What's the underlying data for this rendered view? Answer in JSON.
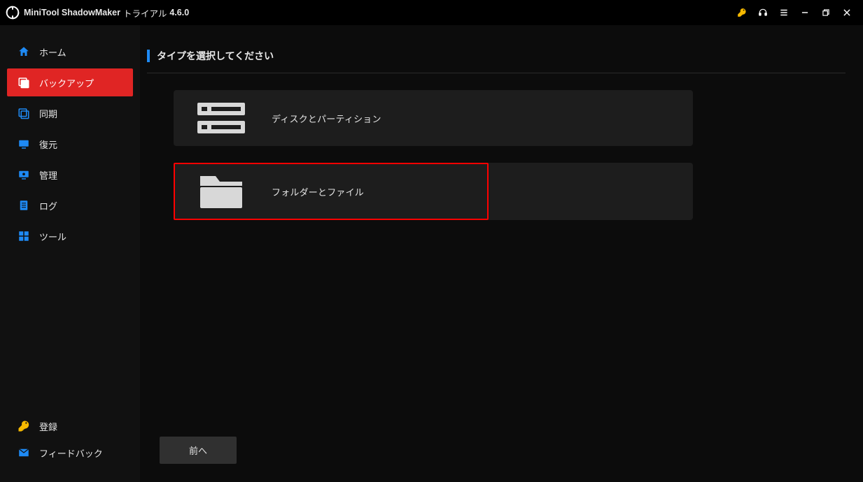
{
  "app": {
    "name": "MiniTool ShadowMaker",
    "edition": "トライアル",
    "version": "4.6.0"
  },
  "sidebar": {
    "items": [
      {
        "label": "ホーム"
      },
      {
        "label": "バックアップ"
      },
      {
        "label": "同期"
      },
      {
        "label": "復元"
      },
      {
        "label": "管理"
      },
      {
        "label": "ログ"
      },
      {
        "label": "ツール"
      }
    ],
    "footer": [
      {
        "label": "登録"
      },
      {
        "label": "フィードバック"
      }
    ]
  },
  "main": {
    "heading": "タイプを選択してください",
    "options": [
      {
        "label": "ディスクとパーティション"
      },
      {
        "label": "フォルダーとファイル"
      }
    ],
    "back_button": "前へ"
  }
}
